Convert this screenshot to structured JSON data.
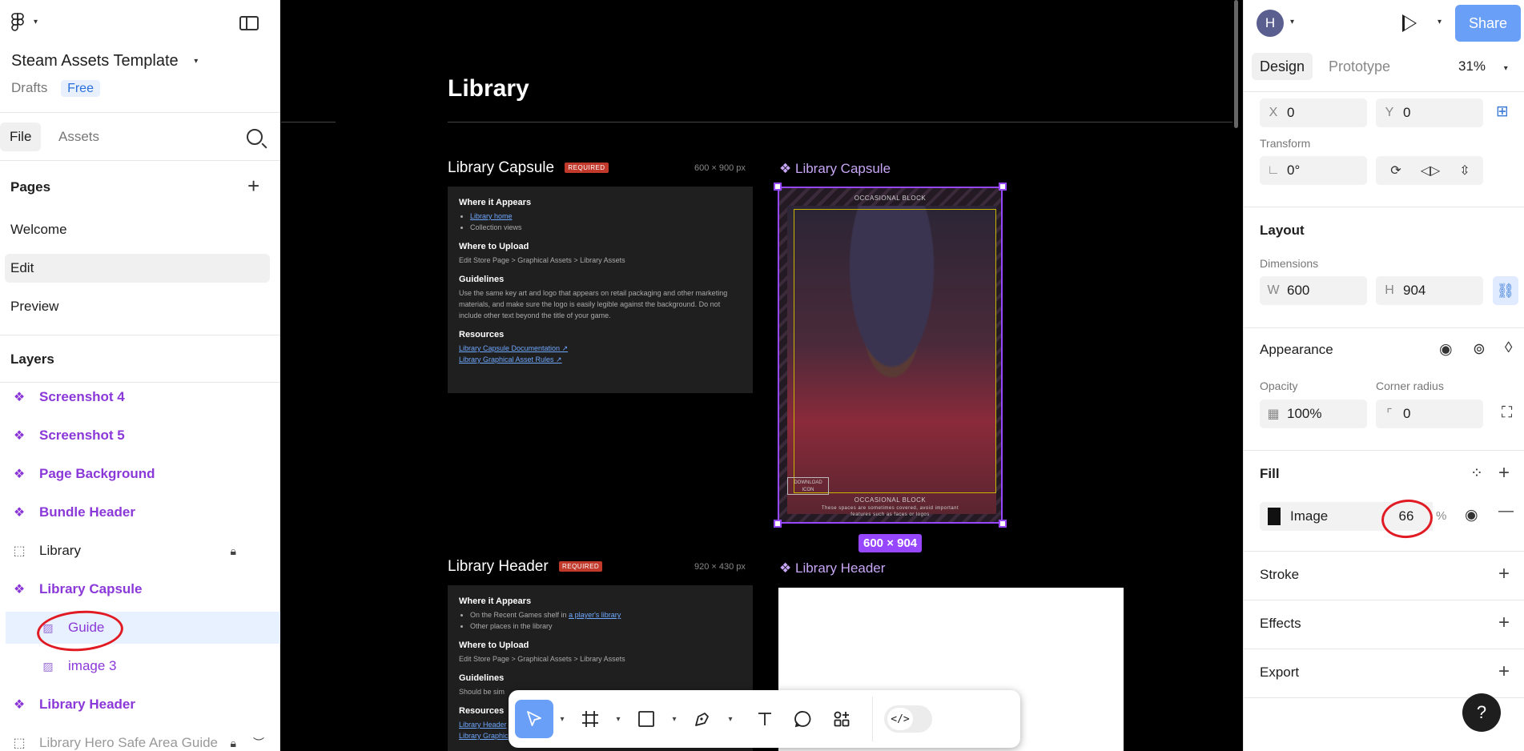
{
  "left_panel": {
    "project_title": "Steam Assets Template",
    "drafts_label": "Drafts",
    "plan_badge": "Free",
    "tabs": {
      "file": "File",
      "assets": "Assets"
    },
    "pages_title": "Pages",
    "pages": [
      {
        "label": "Welcome"
      },
      {
        "label": "Edit",
        "active": true
      },
      {
        "label": "Preview"
      }
    ],
    "layers_title": "Layers",
    "layers": [
      {
        "label": "Screenshot 4",
        "kind": "component"
      },
      {
        "label": "Screenshot 5",
        "kind": "component"
      },
      {
        "label": "Page Background",
        "kind": "component"
      },
      {
        "label": "Bundle Header",
        "kind": "component"
      },
      {
        "label": "Library",
        "kind": "frame",
        "locked": true
      },
      {
        "label": "Library Capsule",
        "kind": "component"
      },
      {
        "label": "Guide",
        "kind": "image",
        "selected": true
      },
      {
        "label": "image 3",
        "kind": "image"
      },
      {
        "label": "Library Header",
        "kind": "component"
      },
      {
        "label": "Library Hero Safe Area Guide",
        "kind": "frame",
        "locked": true,
        "hidden": true
      }
    ]
  },
  "canvas": {
    "title": "Library",
    "capsule": {
      "heading": "Library Capsule",
      "required_badge": "REQUIRED",
      "dims": "600 × 900 px",
      "where_title": "Where it Appears",
      "where_link": "Library home",
      "where_item": "Collection views",
      "upload_title": "Where to Upload",
      "upload_path": "Edit Store Page > Graphical Assets > Library Assets",
      "guidelines_title": "Guidelines",
      "guidelines_text": "Use the same key art and logo that appears on retail packaging and other marketing materials, and make sure the logo is easily legible against the background. Do not include other text beyond the title of your game.",
      "resources_title": "Resources",
      "resource_1": "Library Capsule Documentation ↗",
      "resource_2": "Library Graphical Asset Rules ↗"
    },
    "capsule_component_label": "Library Capsule",
    "occasional_block_top": "OCCASIONAL BLOCK",
    "occasional_block_bottom": "OCCASIONAL BLOCK",
    "occasional_note": "These spaces are sometimes covered, avoid important features such as faces or logos",
    "download_icon_text": "DOWNLOAD ICON",
    "selection_size": "600 × 904",
    "header": {
      "heading": "Library Header",
      "required_badge": "REQUIRED",
      "dims": "920 × 430 px",
      "where_title": "Where it Appears",
      "where_item_prefix": "On the Recent Games shelf in ",
      "where_item_link": "a player's library",
      "where_item_2": "Other places in the library",
      "upload_title": "Where to Upload",
      "upload_path": "Edit Store Page > Graphical Assets > Library Assets",
      "guidelines_title": "Guidelines",
      "guidelines_text": "Should be sim",
      "resources_title": "Resources",
      "resource_1": "Library Header",
      "resource_2": "Library Graphic"
    },
    "header_component_label": "Library Header"
  },
  "toolbar": {
    "tools": [
      "move-tool",
      "frame-tool",
      "shape-tool",
      "pen-tool",
      "text-tool",
      "comment-tool",
      "actions-tool"
    ],
    "dev_mode_glyph": "</>"
  },
  "right_panel": {
    "avatar_initial": "H",
    "share_label": "Share",
    "tabs": {
      "design": "Design",
      "prototype": "Prototype"
    },
    "zoom": "31%",
    "position": {
      "x_label": "X",
      "x": "0",
      "y_label": "Y",
      "y": "0"
    },
    "transform_label": "Transform",
    "rotation": "0°",
    "layout_title": "Layout",
    "dimensions_label": "Dimensions",
    "width_label": "W",
    "width": "600",
    "height_label": "H",
    "height": "904",
    "appearance_title": "Appearance",
    "opacity_label": "Opacity",
    "opacity": "100%",
    "corner_radius_label": "Corner radius",
    "corner_radius": "0",
    "fill_title": "Fill",
    "fill_type": "Image",
    "fill_opacity": "66",
    "fill_pct_sign": "%",
    "stroke_title": "Stroke",
    "effects_title": "Effects",
    "export_title": "Export",
    "help": "?"
  },
  "colors": {
    "accent_blue": "#6a9ff7",
    "component_purple": "#8b38d9",
    "selection_purple": "#9747ff",
    "annotation_red": "#e01b24"
  }
}
